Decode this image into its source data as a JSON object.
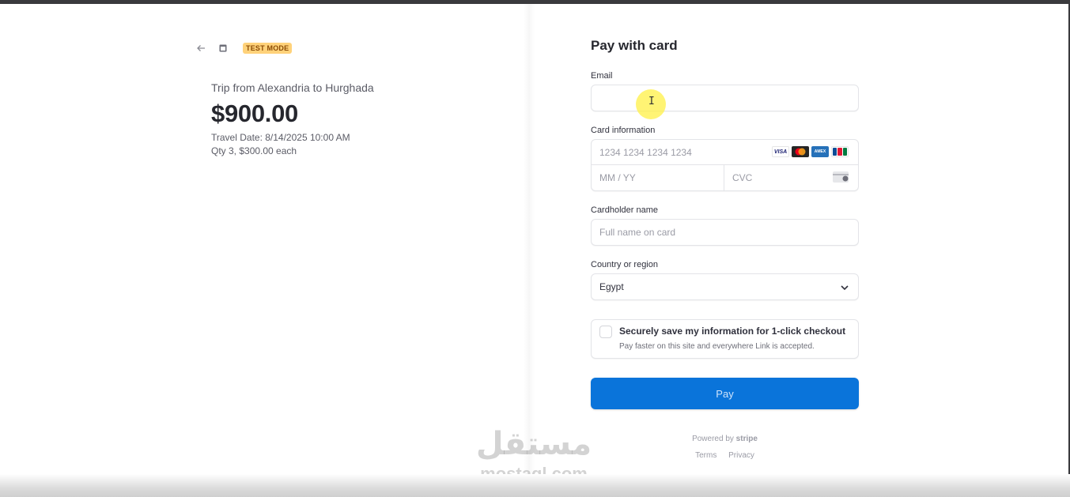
{
  "summary": {
    "badge": "TEST MODE",
    "product_name": "Trip from Alexandria to Hurghada",
    "amount": "$900.00",
    "travel_date": "Travel Date: 8/14/2025 10:00 AM",
    "quantity": "Qty 3, $300.00 each"
  },
  "form": {
    "title": "Pay with card",
    "email_label": "Email",
    "email_value": "",
    "card_label": "Card information",
    "card_number_placeholder": "1234 1234 1234 1234",
    "expiry_placeholder": "MM / YY",
    "cvc_placeholder": "CVC",
    "brands": [
      "VISA",
      "mastercard-icon",
      "AMEX",
      "jcb-icon"
    ],
    "cardholder_label": "Cardholder name",
    "cardholder_placeholder": "Full name on card",
    "country_label": "Country or region",
    "country_value": "Egypt",
    "save_title": "Securely save my information for 1-click checkout",
    "save_subtitle": "Pay faster on this site and everywhere Link is accepted.",
    "pay_label": "Pay"
  },
  "footer": {
    "powered_prefix": "Powered by",
    "powered_brand": "stripe",
    "terms": "Terms",
    "privacy": "Privacy"
  },
  "watermark": {
    "arabic": "مستقل",
    "latin": "mostaql.com"
  },
  "colors": {
    "pay_button": "#0a74da",
    "badge_bg": "#ffd27a",
    "cursor_highlight": "#fff046"
  }
}
